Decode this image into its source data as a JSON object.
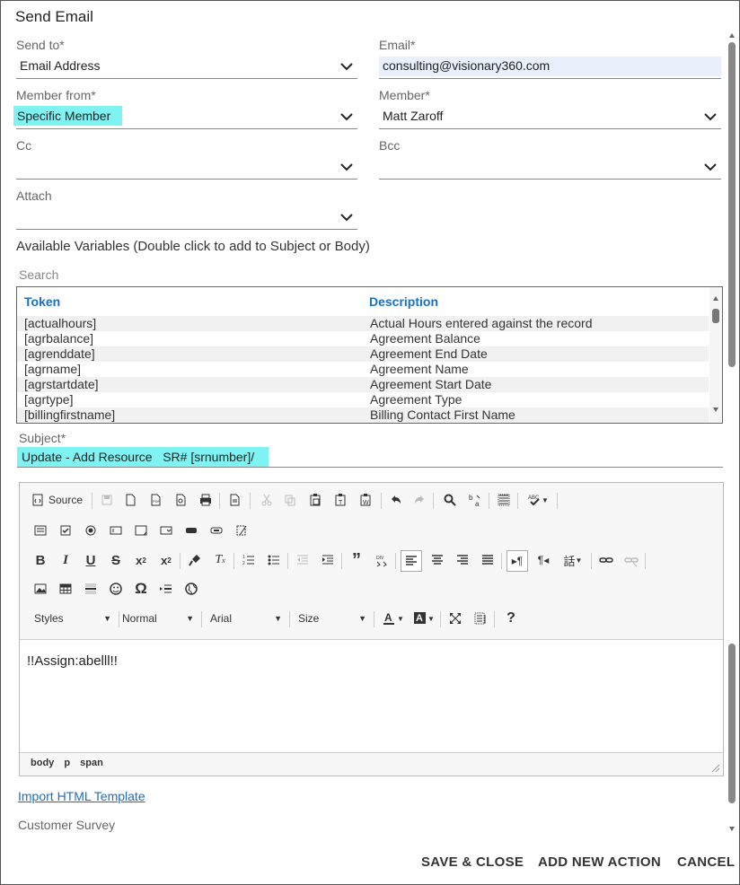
{
  "dialog": {
    "title": "Send Email"
  },
  "fields": {
    "send_to": {
      "label": "Send to*",
      "value": "Email Address"
    },
    "email": {
      "label": "Email*",
      "value": "consulting@visionary360.com"
    },
    "member_from": {
      "label": "Member from*",
      "value": "Specific Member"
    },
    "member": {
      "label": "Member*",
      "value": "Matt Zaroff"
    },
    "cc": {
      "label": "Cc",
      "value": ""
    },
    "bcc": {
      "label": "Bcc",
      "value": ""
    },
    "attach": {
      "label": "Attach",
      "value": ""
    }
  },
  "variables": {
    "title": "Available Variables (Double click to add to Subject or Body)",
    "search_placeholder": "Search",
    "headers": {
      "token": "Token",
      "description": "Description"
    },
    "rows": [
      {
        "token": "[actualhours]",
        "description": "Actual Hours entered against the record"
      },
      {
        "token": "[agrbalance]",
        "description": "Agreement Balance"
      },
      {
        "token": "[agrenddate]",
        "description": "Agreement End Date"
      },
      {
        "token": "[agrname]",
        "description": "Agreement Name"
      },
      {
        "token": "[agrstartdate]",
        "description": "Agreement Start Date"
      },
      {
        "token": "[agrtype]",
        "description": "Agreement Type"
      },
      {
        "token": "[billingfirstname]",
        "description": "Billing Contact First Name"
      }
    ]
  },
  "subject": {
    "label": "Subject*",
    "value": "Update - Add Resource   SR# [srnumber]/"
  },
  "editor": {
    "source_label": "Source",
    "styles_label": "Styles",
    "format_label": "Normal",
    "font_label": "Arial",
    "size_label": "Size",
    "body_text": "!!Assign:abelll!!",
    "path": {
      "body": "body",
      "p": "p",
      "span": "span"
    }
  },
  "links": {
    "import_template": "Import HTML Template"
  },
  "survey": {
    "label": "Customer Survey"
  },
  "footer": {
    "save_close": "SAVE & CLOSE",
    "add_new_action": "ADD NEW ACTION",
    "cancel": "CANCEL"
  }
}
